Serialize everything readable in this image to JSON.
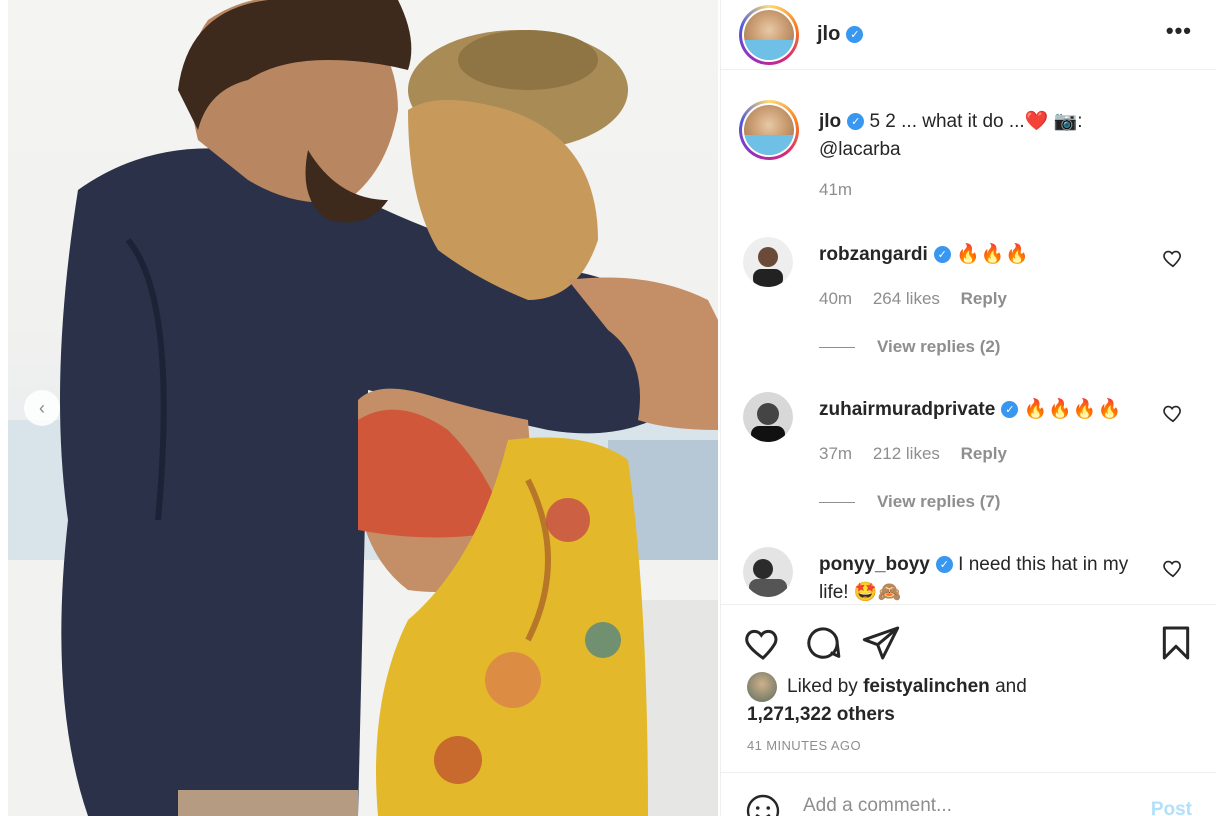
{
  "post": {
    "username": "jlo",
    "verified_mark": "✓",
    "more_icon": "•••",
    "caption": {
      "username": "jlo",
      "text": "5 2 ... what it do ...❤️ 📷:",
      "mention": "@lacarba",
      "time": "41m"
    },
    "comments": [
      {
        "username": "robzangardi",
        "text": "🔥🔥🔥",
        "time": "40m",
        "likes": "264 likes",
        "reply": "Reply",
        "view_replies": "View replies (2)"
      },
      {
        "username": "zuhairmuradprivate",
        "text": "🔥🔥🔥🔥",
        "time": "37m",
        "likes": "212 likes",
        "reply": "Reply",
        "view_replies": "View replies (7)"
      },
      {
        "username": "ponyy_boyy",
        "text": "I need this hat in my life! 🤩🙈"
      }
    ],
    "liked_by": {
      "prefix": "Liked by",
      "user": "feistyalinchen",
      "and": "and",
      "others": "1,271,322 others"
    },
    "time_ago": "41 MINUTES AGO",
    "add_comment_placeholder": "Add a comment...",
    "post_label": "Post"
  },
  "icons": {
    "carousel_prev": "chevron-left-icon",
    "like": "heart-icon",
    "comment": "comment-icon",
    "share": "paper-plane-icon",
    "save": "bookmark-icon",
    "emoji": "smiley-icon"
  },
  "colors": {
    "verified": "#3897f0",
    "post_button": "#b2dffc",
    "muted_text": "#8e8e8e"
  }
}
